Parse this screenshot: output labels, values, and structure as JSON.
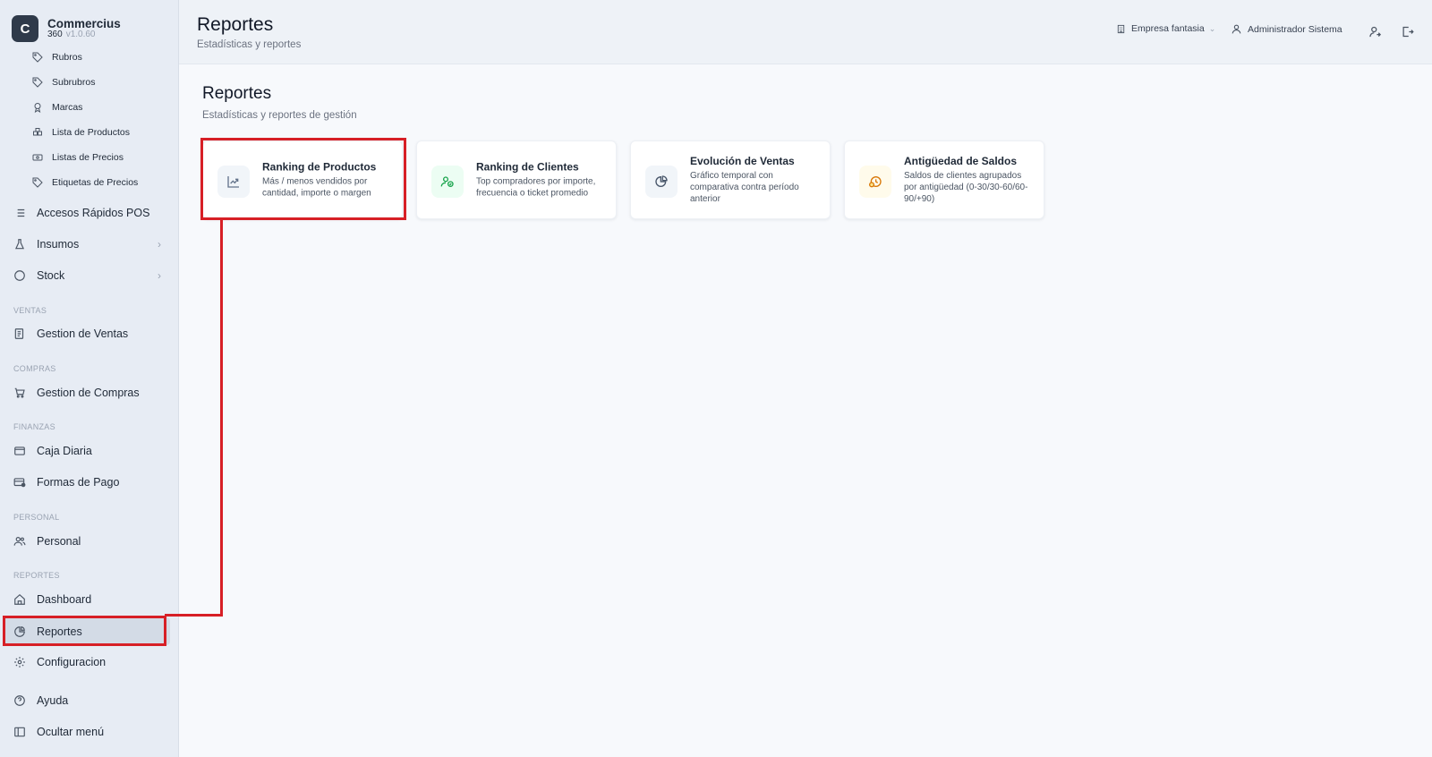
{
  "brand": {
    "logo_letter": "C",
    "name": "Commercius",
    "sub": "360",
    "version": "v1.0.60"
  },
  "sidebar": {
    "sub_items": [
      {
        "label": "Rubros",
        "icon": "tag-icon"
      },
      {
        "label": "Subrubros",
        "icon": "tag-icon"
      },
      {
        "label": "Marcas",
        "icon": "award-icon"
      },
      {
        "label": "Lista de Productos",
        "icon": "boxes-icon"
      },
      {
        "label": "Listas de Precios",
        "icon": "banknote-icon"
      },
      {
        "label": "Etiquetas de Precios",
        "icon": "tag-icon"
      }
    ],
    "items": {
      "accesos": "Accesos Rápidos POS",
      "insumos": "Insumos",
      "stock": "Stock",
      "gestion_ventas": "Gestion de Ventas",
      "gestion_compras": "Gestion de Compras",
      "caja_diaria": "Caja Diaria",
      "formas_pago": "Formas de Pago",
      "personal": "Personal",
      "dashboard": "Dashboard",
      "reportes": "Reportes",
      "configuracion": "Configuracion",
      "ayuda": "Ayuda",
      "ocultar": "Ocultar menú"
    },
    "sections": {
      "ventas": "VENTAS",
      "compras": "COMPRAS",
      "finanzas": "FINANZAS",
      "personal": "PERSONAL",
      "reportes": "REPORTES"
    },
    "active": "Reportes"
  },
  "header": {
    "title": "Reportes",
    "subtitle": "Estadísticas y reportes",
    "company": "Empresa fantasia",
    "user": "Administrador Sistema"
  },
  "main": {
    "title": "Reportes",
    "subtitle": "Estadísticas y reportes de gestión",
    "cards": [
      {
        "title": "Ranking de Productos",
        "description": "Más / menos vendidos por cantidad, importe o margen",
        "icon": "trending-up-icon",
        "color": "#64748b"
      },
      {
        "title": "Ranking de Clientes",
        "description": "Top compradores por importe, frecuencia o ticket promedio",
        "icon": "users-icon",
        "color": "#16a34a"
      },
      {
        "title": "Evolución de Ventas",
        "description": "Gráfico temporal con comparativa contra período anterior",
        "icon": "chart-pie-icon",
        "color": "#475569"
      },
      {
        "title": "Antigüedad de Saldos",
        "description": "Saldos de clientes agrupados por antigüedad (0-30/30-60/60-90/+90)",
        "icon": "clock-alert-icon",
        "color": "#d97706"
      }
    ]
  },
  "colors": {
    "highlight": "#d71f26",
    "sidebar_bg": "#e7ecf4",
    "active_bg": "#d3dbe6"
  }
}
